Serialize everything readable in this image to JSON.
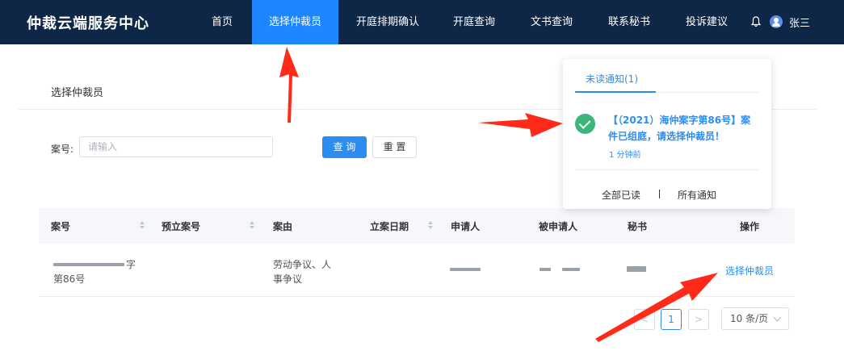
{
  "app": {
    "title": "仲裁云端服务中心"
  },
  "nav": {
    "items": [
      {
        "label": "首页",
        "active": false
      },
      {
        "label": "选择仲裁员",
        "active": true
      },
      {
        "label": "开庭排期确认",
        "active": false
      },
      {
        "label": "开庭查询",
        "active": false
      },
      {
        "label": "文书查询",
        "active": false
      },
      {
        "label": "联系秘书",
        "active": false
      },
      {
        "label": "投诉建议",
        "active": false
      }
    ],
    "user": "张三",
    "icons": [
      "bell-icon",
      "user-avatar-icon"
    ]
  },
  "page": {
    "title": "选择仲裁员"
  },
  "search": {
    "label": "案号:",
    "placeholder": "请输入",
    "value": "",
    "search_button": "查 询",
    "reset_button": "重 置"
  },
  "table": {
    "columns": [
      "案号",
      "预立案号",
      "案由",
      "立案日期",
      "申请人",
      "被申请人",
      "秘书",
      "操作"
    ],
    "rows": [
      {
        "case_no_line1": "字",
        "case_no_line2": "第86号",
        "pre_case_no": "",
        "cause_line1": "劳动争议、人",
        "cause_line2": "事争议",
        "action": "选择仲裁员"
      }
    ]
  },
  "pagination": {
    "prev": "<",
    "current": "1",
    "next": ">",
    "page_size": "10 条/页"
  },
  "notification": {
    "tab": "未读通知(1)",
    "message": "【（2021）海仲案字第86号】案件已组庭，请选择仲裁员！",
    "time": "1 分钟前",
    "mark_all_read": "全部已读",
    "all_notifications": "所有通知"
  },
  "colors": {
    "nav_bg": "#0f2746",
    "accent": "#1e86ff",
    "link": "#2d8cf0",
    "success": "#3ab67a",
    "arrow": "#ff2a1a"
  }
}
